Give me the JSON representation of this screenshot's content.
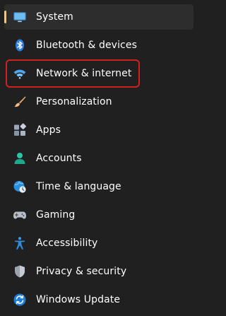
{
  "sidebar": {
    "items": [
      {
        "label": "System",
        "icon": "display-icon",
        "selected": true
      },
      {
        "label": "Bluetooth & devices",
        "icon": "bluetooth-icon",
        "selected": false
      },
      {
        "label": "Network & internet",
        "icon": "wifi-icon",
        "selected": false
      },
      {
        "label": "Personalization",
        "icon": "paintbrush-icon",
        "selected": false
      },
      {
        "label": "Apps",
        "icon": "apps-icon",
        "selected": false
      },
      {
        "label": "Accounts",
        "icon": "person-icon",
        "selected": false
      },
      {
        "label": "Time & language",
        "icon": "globe-clock-icon",
        "selected": false
      },
      {
        "label": "Gaming",
        "icon": "gamepad-icon",
        "selected": false
      },
      {
        "label": "Accessibility",
        "icon": "accessibility-icon",
        "selected": false
      },
      {
        "label": "Privacy & security",
        "icon": "shield-icon",
        "selected": false
      },
      {
        "label": "Windows Update",
        "icon": "update-icon",
        "selected": false
      }
    ],
    "highlighted_item": "Network & internet"
  },
  "colors": {
    "background": "#202020",
    "selected_background": "#2d2d2d",
    "selection_indicator": "#e8c691",
    "highlight_outline": "#d12020",
    "text": "#ffffff"
  }
}
